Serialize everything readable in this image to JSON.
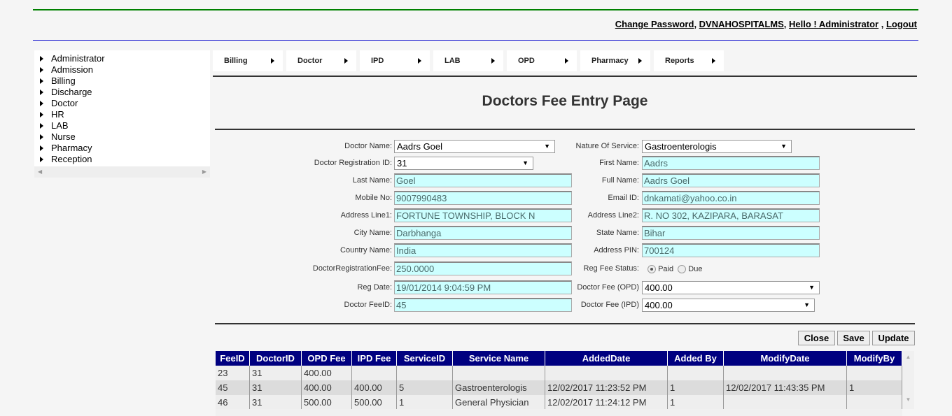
{
  "header": {
    "links": [
      "Change Password",
      "DVNAHOSPITALMS",
      "Hello ! Administrator",
      "Logout"
    ]
  },
  "sidebar": {
    "items": [
      "Administrator",
      "Admission",
      "Billing",
      "Discharge",
      "Doctor",
      "HR",
      "LAB",
      "Nurse",
      "Pharmacy",
      "Reception"
    ]
  },
  "menu": {
    "items": [
      "Billing",
      "Doctor",
      "IPD",
      "LAB",
      "OPD",
      "Pharmacy",
      "Reports"
    ]
  },
  "page_title": "Doctors Fee Entry Page",
  "form": {
    "doctor_name": {
      "label": "Doctor Name:",
      "value": "Aadrs Goel"
    },
    "nature_of_service": {
      "label": "Nature Of Service:",
      "value": "Gastroenterologis"
    },
    "doctor_reg_id": {
      "label": "Doctor Registration ID:",
      "value": "31"
    },
    "first_name": {
      "label": "First Name:",
      "value": "Aadrs"
    },
    "last_name": {
      "label": "Last Name:",
      "value": "Goel"
    },
    "full_name": {
      "label": "Full Name:",
      "value": "Aadrs Goel"
    },
    "mobile": {
      "label": "Mobile No:",
      "value": "9007990483"
    },
    "email": {
      "label": "Email ID:",
      "value": "dnkamati@yahoo.co.in"
    },
    "address1": {
      "label": "Address Line1:",
      "value": "FORTUNE TOWNSHIP, BLOCK N"
    },
    "address2": {
      "label": "Address Line2:",
      "value": "R. NO 302, KAZIPARA, BARASAT"
    },
    "city": {
      "label": "City Name:",
      "value": "Darbhanga"
    },
    "state": {
      "label": "State Name:",
      "value": "Bihar"
    },
    "country": {
      "label": "Country Name:",
      "value": "India"
    },
    "pin": {
      "label": "Address PIN:",
      "value": "700124"
    },
    "reg_fee": {
      "label": "DoctorRegistrationFee:",
      "value": "250.0000"
    },
    "reg_fee_status": {
      "label": "Reg Fee Status:",
      "options": [
        "Paid",
        "Due"
      ],
      "selected": "Paid"
    },
    "reg_date": {
      "label": "Reg Date:",
      "value": "19/01/2014 9:04:59 PM"
    },
    "fee_opd": {
      "label": "Doctor Fee (OPD)",
      "value": "400.00"
    },
    "fee_id": {
      "label": "Doctor FeeID:",
      "value": "45"
    },
    "fee_ipd": {
      "label": "Doctor Fee (IPD)",
      "value": "400.00"
    }
  },
  "buttons": {
    "close": "Close",
    "save": "Save",
    "update": "Update"
  },
  "grid": {
    "headers": [
      "FeeID",
      "DoctorID",
      "OPD Fee",
      "IPD Fee",
      "ServiceID",
      "Service Name",
      "AddedDate",
      "Added By",
      "ModifyDate",
      "ModifyBy"
    ],
    "rows": [
      [
        "23",
        "31",
        "400.00",
        "",
        "",
        "",
        "",
        "",
        "",
        ""
      ],
      [
        "45",
        "31",
        "400.00",
        "400.00",
        "5",
        "Gastroenterologis",
        "12/02/2017 11:23:52 PM",
        "1",
        "12/02/2017 11:43:35 PM",
        "1"
      ],
      [
        "46",
        "31",
        "500.00",
        "500.00",
        "1",
        "General Physician",
        "12/02/2017 11:24:12 PM",
        "1",
        "",
        ""
      ]
    ]
  },
  "colors": {
    "header_bg": "#000080",
    "input_bg": "#ccffff",
    "top_line": "#008000",
    "blue_line": "#0000cc"
  }
}
